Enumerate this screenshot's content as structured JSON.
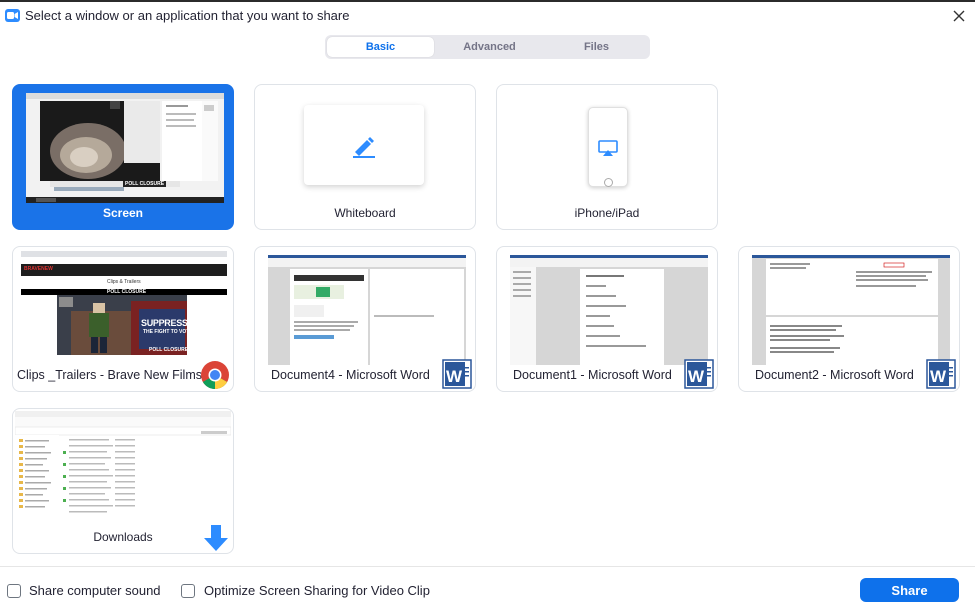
{
  "window": {
    "title": "Select a window or an application that you want to share"
  },
  "tabs": [
    {
      "label": "Basic",
      "active": true
    },
    {
      "label": "Advanced",
      "active": false
    },
    {
      "label": "Files",
      "active": false
    }
  ],
  "tiles": [
    {
      "label": "Screen",
      "selected": true
    },
    {
      "label": "Whiteboard",
      "icon": "pen-icon"
    },
    {
      "label": "iPhone/iPad",
      "icon": "airplay-icon"
    },
    {
      "label": "Clips _Trailers - Brave New Films -...",
      "app_icon": "chrome-icon",
      "thumb_text": {
        "brand": "BRAVENEW",
        "heading": "Clips & Trailers",
        "banner": "POLL CLOSURE",
        "overlay1": "SUPPRESSED",
        "overlay2": "THE FIGHT TO VOTE",
        "overlay3": "POLL CLOSURE"
      }
    },
    {
      "label": "Document4 - Microsoft Word",
      "app_icon": "word-icon"
    },
    {
      "label": "Document1 - Microsoft Word",
      "app_icon": "word-icon"
    },
    {
      "label": "Document2 - Microsoft Word",
      "app_icon": "word-icon"
    },
    {
      "label": "Downloads",
      "app_icon": "download-arrow-icon"
    }
  ],
  "screen_thumb": {
    "banner": "POLL CLOSURE"
  },
  "footer": {
    "share_sound_label": "Share computer sound",
    "share_sound_checked": false,
    "optimize_label": "Optimize Screen Sharing for Video Clip",
    "optimize_checked": false,
    "share_button": "Share"
  },
  "colors": {
    "accent": "#0e71eb",
    "selected_tile": "#1a73e8",
    "word_blue": "#2b579a"
  }
}
